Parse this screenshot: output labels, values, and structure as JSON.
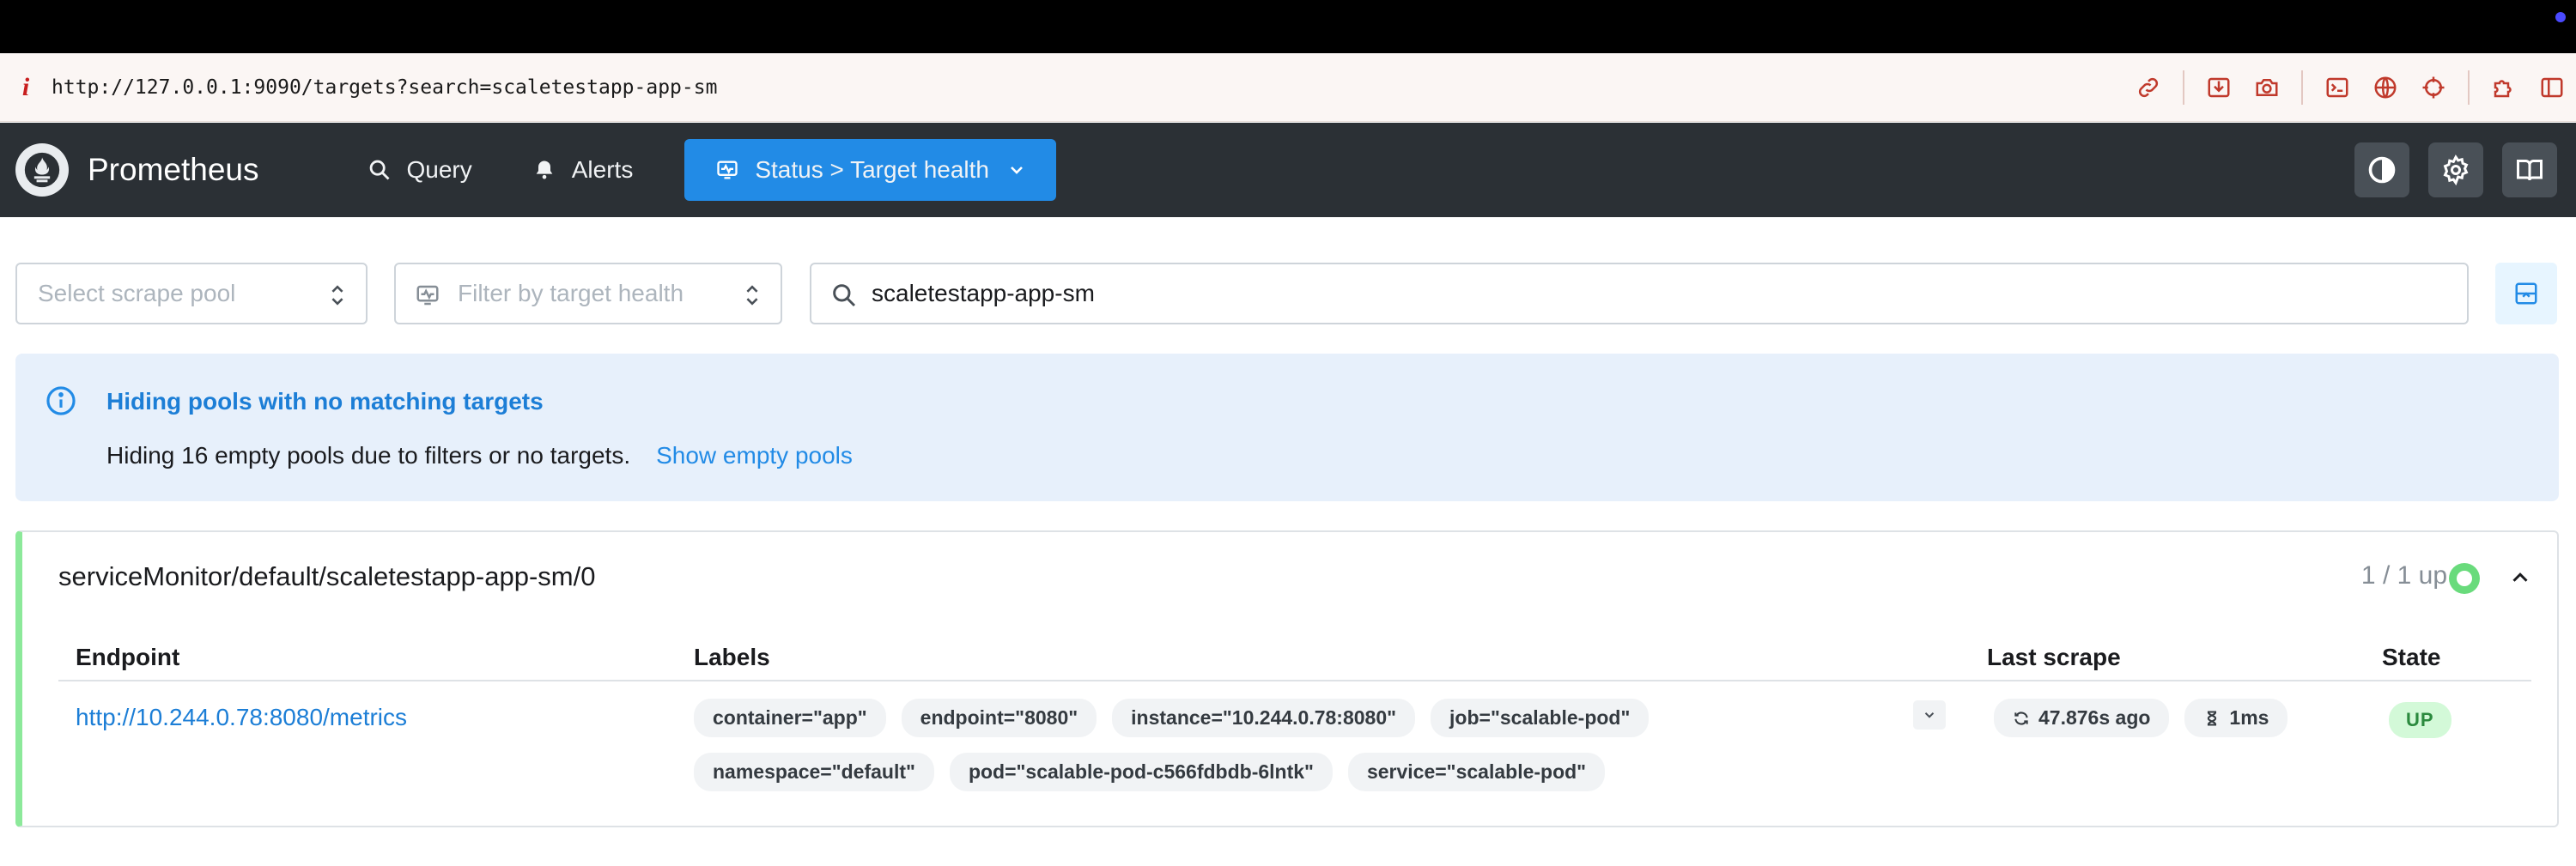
{
  "browser": {
    "url": "http://127.0.0.1:9090/targets?search=scaletestapp-app-sm",
    "tools": [
      "link-icon",
      "save-icon",
      "camera-icon",
      "terminal-icon",
      "globe-icon",
      "crosshair-icon",
      "puzzle-icon",
      "sidebar-icon"
    ]
  },
  "header": {
    "brand": "Prometheus",
    "nav": {
      "query": "Query",
      "alerts": "Alerts",
      "status": "Status > Target health"
    }
  },
  "filters": {
    "scrape_pool_placeholder": "Select scrape pool",
    "health_placeholder": "Filter by target health",
    "search_value": "scaletestapp-app-sm"
  },
  "alert": {
    "title": "Hiding pools with no matching targets",
    "message": "Hiding 16 empty pools due to filters or no targets.",
    "link": "Show empty pools"
  },
  "pool": {
    "name": "serviceMonitor/default/scaletestapp-app-sm/0",
    "up_count": "1 / 1 up",
    "columns": {
      "endpoint": "Endpoint",
      "labels": "Labels",
      "last_scrape": "Last scrape",
      "state": "State"
    },
    "targets": [
      {
        "endpoint": "http://10.244.0.78:8080/metrics",
        "labels": [
          "container=\"app\"",
          "endpoint=\"8080\"",
          "instance=\"10.244.0.78:8080\"",
          "job=\"scalable-pod\"",
          "namespace=\"default\"",
          "pod=\"scalable-pod-c566fdbdb-6lntk\"",
          "service=\"scalable-pod\""
        ],
        "last_scrape": "47.876s ago",
        "scrape_duration": "1ms",
        "state": "UP"
      }
    ]
  },
  "colors": {
    "header_bg": "#2b3035",
    "accent": "#228be6",
    "alert_bg": "#e7f0fb",
    "up_green": "#69db7c"
  }
}
